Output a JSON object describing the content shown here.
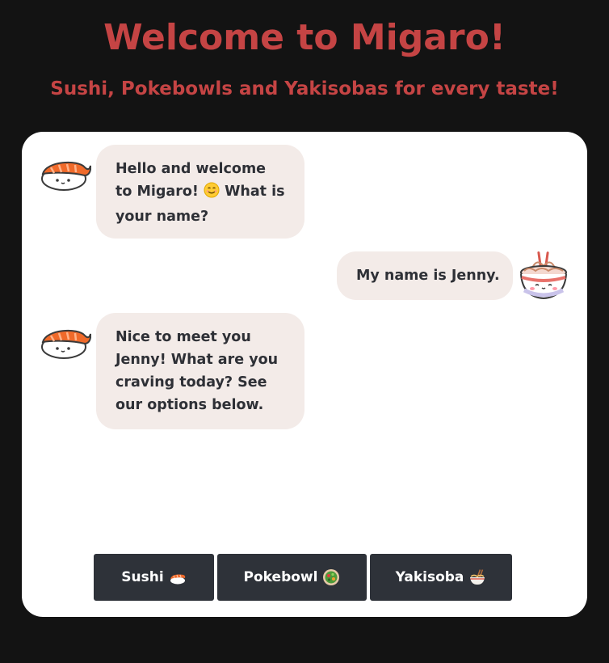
{
  "header": {
    "title": "Welcome to Migaro!",
    "subtitle": "Sushi, Pokebowls and Yakisobas for every taste!"
  },
  "chat": {
    "messages": [
      {
        "sender": "bot",
        "avatar": "sushi-avatar-icon",
        "text_before": "Hello and welcome to Migaro!",
        "emoji": "smiling-face-icon",
        "text_after": "What is your name?"
      },
      {
        "sender": "user",
        "avatar": "noodle-bowl-avatar-icon",
        "text": "My name is Jenny."
      },
      {
        "sender": "bot",
        "avatar": "sushi-avatar-icon",
        "text": "Nice to meet you Jenny! What are you craving today? See our options below."
      }
    ]
  },
  "options": [
    {
      "label": "Sushi",
      "icon": "sushi-icon"
    },
    {
      "label": "Pokebowl",
      "icon": "salad-bowl-icon"
    },
    {
      "label": "Yakisoba",
      "icon": "noodle-bowl-icon"
    }
  ],
  "colors": {
    "background": "#131313",
    "accent": "#c54444",
    "card": "#ffffff",
    "bubble": "#f3ebe8",
    "bubble_text": "#2e3036",
    "button": "#2e3239",
    "button_text": "#ffffff"
  }
}
